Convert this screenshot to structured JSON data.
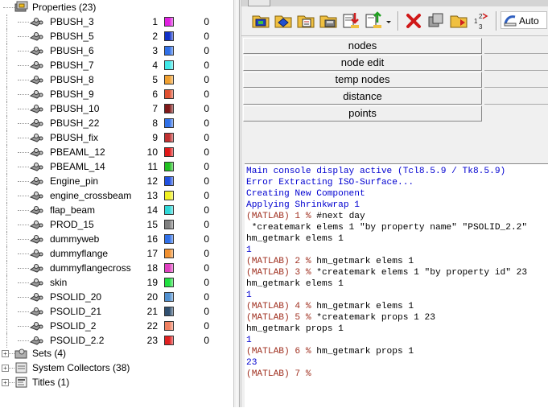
{
  "tree": {
    "properties": {
      "label": "Properties (23)"
    },
    "items": [
      {
        "name": "PBUSH_3",
        "id": "1",
        "color": "#e020e0",
        "count": "0"
      },
      {
        "name": "PBUSH_5",
        "id": "2",
        "color": "#1030c8",
        "count": "0"
      },
      {
        "name": "PBUSH_6",
        "id": "3",
        "color": "#3070e8",
        "count": "0"
      },
      {
        "name": "PBUSH_7",
        "id": "4",
        "color": "#40e8e8",
        "count": "0"
      },
      {
        "name": "PBUSH_8",
        "id": "5",
        "color": "#f0a030",
        "count": "0"
      },
      {
        "name": "PBUSH_9",
        "id": "6",
        "color": "#e05030",
        "count": "0"
      },
      {
        "name": "PBUSH_10",
        "id": "7",
        "color": "#801818",
        "count": "0"
      },
      {
        "name": "PBUSH_22",
        "id": "8",
        "color": "#3070e8",
        "count": "0"
      },
      {
        "name": "PBUSH_fix",
        "id": "9",
        "color": "#c03030",
        "count": "0"
      },
      {
        "name": "PBEAML_12",
        "id": "10",
        "color": "#e01818",
        "count": "0"
      },
      {
        "name": "PBEAML_14",
        "id": "11",
        "color": "#20c020",
        "count": "0"
      },
      {
        "name": "Engine_pin",
        "id": "12",
        "color": "#2050e0",
        "count": "0"
      },
      {
        "name": "engine_crossbeam",
        "id": "13",
        "color": "#f0f020",
        "count": "0"
      },
      {
        "name": "flap_beam",
        "id": "14",
        "color": "#30d8d8",
        "count": "0"
      },
      {
        "name": "PROD_15",
        "id": "15",
        "color": "#808080",
        "count": "0"
      },
      {
        "name": "dummyweb",
        "id": "16",
        "color": "#3070e8",
        "count": "0"
      },
      {
        "name": "dummyflange",
        "id": "17",
        "color": "#f09030",
        "count": "0"
      },
      {
        "name": "dummyflangecross",
        "id": "18",
        "color": "#e040c0",
        "count": "0"
      },
      {
        "name": "skin",
        "id": "19",
        "color": "#20e040",
        "count": "0"
      },
      {
        "name": "PSOLID_20",
        "id": "20",
        "color": "#5090d0",
        "count": "0"
      },
      {
        "name": "PSOLID_21",
        "id": "21",
        "color": "#305070",
        "count": "0"
      },
      {
        "name": "PSOLID_2",
        "id": "22",
        "color": "#f08060",
        "count": "0"
      },
      {
        "name": "PSOLID_2.2",
        "id": "23",
        "color": "#e02020",
        "count": "0"
      }
    ],
    "sets": {
      "label": "Sets (4)"
    },
    "collectors": {
      "label": "System Collectors (38)"
    },
    "titles": {
      "label": "Titles (1)"
    }
  },
  "toolbar": {
    "auto_label": "Auto",
    "icons": [
      "import-model-icon",
      "export-model-icon",
      "print-icon",
      "save-model-icon",
      "import-solver-icon",
      "export-solver-icon",
      "delete-icon",
      "mask-icon",
      "open-folder-icon",
      "renumber-icon",
      "entity-selector-icon"
    ]
  },
  "nav": {
    "nodes": "nodes",
    "node_edit": "node edit",
    "temp_nodes": "temp nodes",
    "distance": "distance",
    "points": "points"
  },
  "console": {
    "lines": [
      {
        "text": "Main console display active (Tcl8.5.9 / Tk8.5.9)",
        "style": "blue"
      },
      {
        "text": "Error Extracting ISO-Surface...",
        "style": "blue"
      },
      {
        "text": "Creating New Component",
        "style": "blue"
      },
      {
        "text": "Applying Shrinkwrap 1",
        "style": "blue"
      },
      {
        "prompt": "(MATLAB) 1 % ",
        "text": "#next day",
        "style": "prompt"
      },
      {
        "text": " *createmark elems 1 \"by property name\" \"PSOLID_2.2\"",
        "style": "black"
      },
      {
        "text": "hm_getmark elems 1",
        "style": "black"
      },
      {
        "text": "1",
        "style": "blue"
      },
      {
        "prompt": "(MATLAB) 2 % ",
        "text": "hm_getmark elems 1",
        "style": "prompt"
      },
      {
        "prompt": "(MATLAB) 3 % ",
        "text": "*createmark elems 1 \"by property id\" 23",
        "style": "prompt"
      },
      {
        "text": "hm_getmark elems 1",
        "style": "black"
      },
      {
        "text": "1",
        "style": "blue"
      },
      {
        "prompt": "(MATLAB) 4 % ",
        "text": "hm_getmark elems 1",
        "style": "prompt"
      },
      {
        "prompt": "(MATLAB) 5 % ",
        "text": "*createmark props 1 23",
        "style": "prompt"
      },
      {
        "text": "hm_getmark props 1",
        "style": "black"
      },
      {
        "text": "1",
        "style": "blue"
      },
      {
        "prompt": "(MATLAB) 6 % ",
        "text": "hm_getmark props 1",
        "style": "prompt"
      },
      {
        "text": "23",
        "style": "blue"
      },
      {
        "prompt": "(MATLAB) 7 % ",
        "text": "",
        "style": "prompt"
      }
    ]
  }
}
